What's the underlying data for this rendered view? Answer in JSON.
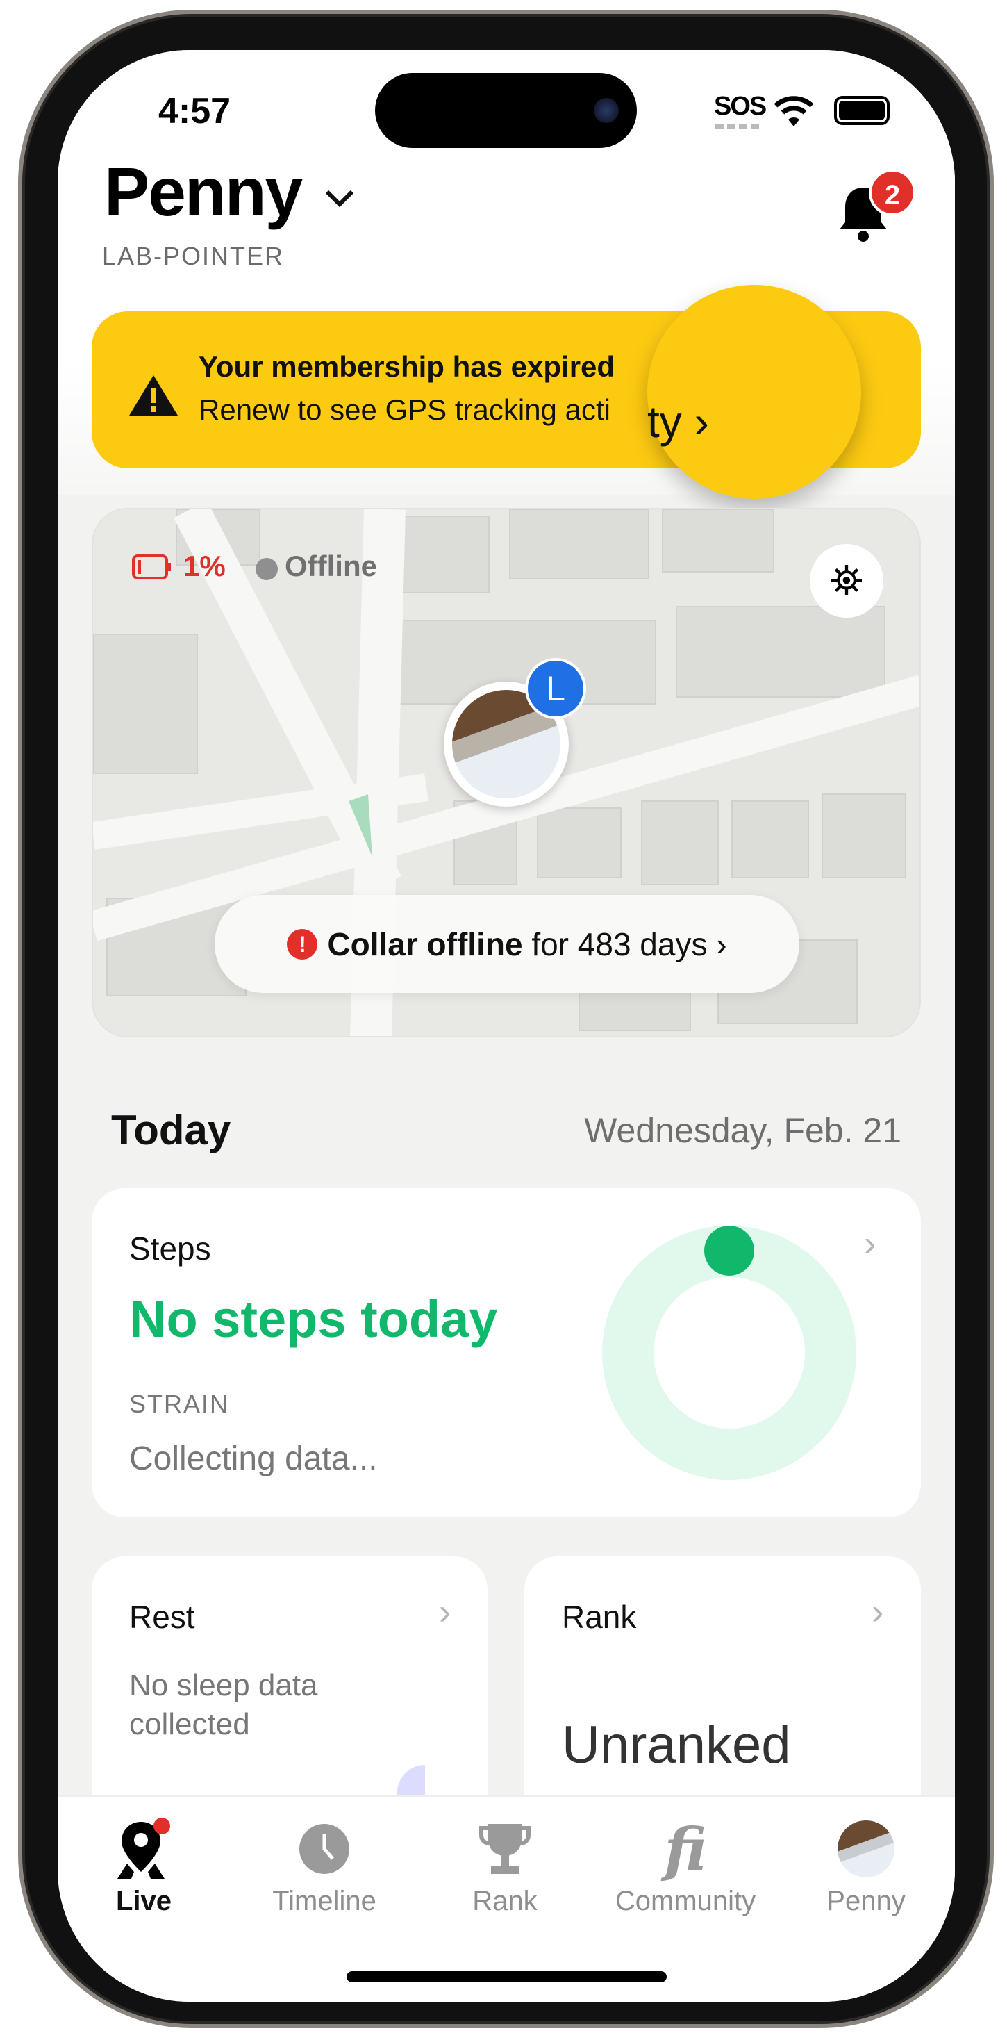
{
  "status_bar": {
    "time": "4:57",
    "sos": "SOS"
  },
  "header": {
    "pet_name": "Penny",
    "breed": "LAB-POINTER",
    "notification_count": "2"
  },
  "banner": {
    "title": "Your membership has expired",
    "subtitle": "Renew to see GPS tracking acti",
    "subtitle_overlay": "ty ›",
    "color": "#FDCA12"
  },
  "map": {
    "battery": "1%",
    "status": "Offline",
    "pet_initial": "L",
    "offline_bold": "Collar offline",
    "offline_rest": "for 483 days ›"
  },
  "today": {
    "heading": "Today",
    "date": "Wednesday, Feb. 21"
  },
  "steps": {
    "label": "Steps",
    "value": "No steps today",
    "strain_label": "STRAIN",
    "strain_value": "Collecting data...",
    "accent": "#11B76B"
  },
  "rest": {
    "label": "Rest",
    "value": "No sleep data collected"
  },
  "rank": {
    "label": "Rank",
    "value": "Unranked"
  },
  "tabs": [
    {
      "label": "Live",
      "icon": "map-pin-icon"
    },
    {
      "label": "Timeline",
      "icon": "clock-icon"
    },
    {
      "label": "Rank",
      "icon": "trophy-icon"
    },
    {
      "label": "Community",
      "icon": "fi-logo-icon"
    },
    {
      "label": "Penny",
      "icon": "avatar"
    }
  ]
}
